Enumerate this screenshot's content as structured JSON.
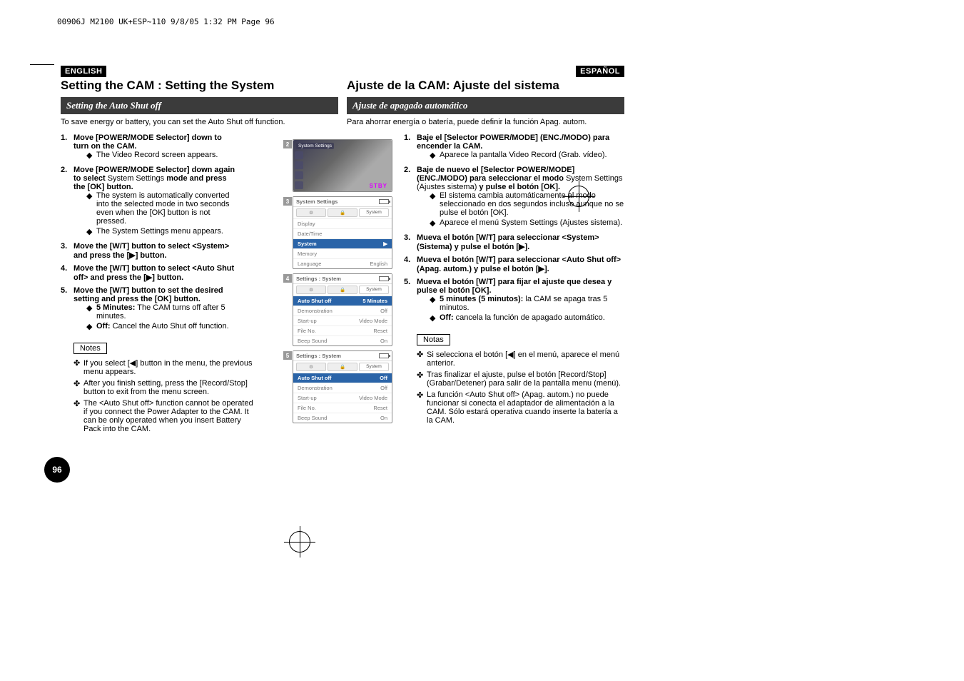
{
  "print_header": "00906J M2100 UK+ESP~110  9/8/05 1:32 PM  Page 96",
  "page_number": "96",
  "left": {
    "lang": "ENGLISH",
    "title": "Setting the CAM : Setting the System",
    "subtitle": "Setting the Auto Shut off",
    "intro": "To save energy or battery, you can set the Auto Shut off function.",
    "steps": [
      {
        "n": "1.",
        "t": "Move [POWER/MODE Selector] down to turn on the CAM.",
        "subs": [
          "The Video Record screen appears."
        ]
      },
      {
        "n": "2.",
        "t": "Move [POWER/MODE Selector] down again to select System Settings mode and press the [OK] button.",
        "subs": [
          "The system is automatically converted into the selected mode in two seconds even when the [OK] button is not pressed.",
          "The System Settings menu appears."
        ]
      },
      {
        "n": "3.",
        "t": "Move the [W/T] button to select <System> and press the [▶] button.",
        "subs": []
      },
      {
        "n": "4.",
        "t": "Move the [W/T] button to select <Auto Shut off> and press the [▶] button.",
        "subs": []
      },
      {
        "n": "5.",
        "t": "Move the [W/T] button to set the desired setting and press the [OK] button.",
        "subs": [
          "5 Minutes: The CAM turns off after 5 minutes.",
          "Off: Cancel the Auto Shut off function."
        ]
      }
    ],
    "notes_label": "Notes",
    "notes": [
      "If you select [◀] button in the menu, the previous menu appears.",
      "After you finish setting, press the [Record/Stop] button to exit from the menu screen.",
      "The <Auto Shut off> function cannot be operated if you connect the Power Adapter to the CAM. It can be only operated when you insert Battery Pack into the CAM."
    ]
  },
  "right": {
    "lang": "ESPAÑOL",
    "title": "Ajuste de la CAM: Ajuste del sistema",
    "subtitle": "Ajuste de apagado automático",
    "intro": "Para ahorrar energía o batería, puede definir la función Apag. autom.",
    "steps": [
      {
        "n": "1.",
        "t": "Baje el [Selector POWER/MODE] (ENC./MODO) para encender la CAM.",
        "subs": [
          "Aparece la pantalla Video Record (Grab. vídeo)."
        ]
      },
      {
        "n": "2.",
        "t": "Baje de nuevo el [Selector POWER/MODE] (ENC./MODO) para seleccionar el modo System Settings (Ajustes sistema) y pulse el botón [OK].",
        "subs": [
          "El sistema cambia automáticamente al modo seleccionado en dos segundos incluso aunque no se pulse el botón [OK].",
          "Aparece el menú System Settings (Ajustes sistema)."
        ]
      },
      {
        "n": "3.",
        "t": "Mueva el botón [W/T] para seleccionar <System> (Sistema) y pulse el botón [▶].",
        "subs": []
      },
      {
        "n": "4.",
        "t": "Mueva el botón [W/T] para seleccionar <Auto Shut off> (Apag. autom.) y pulse el botón [▶].",
        "subs": []
      },
      {
        "n": "5.",
        "t": "Mueva el botón [W/T] para fijar el ajuste que desea y pulse el botón [OK].",
        "subs": [
          "5 minutes (5 minutos): la CAM se apaga tras 5 minutos.",
          "Off: cancela la función de apagado automático."
        ]
      }
    ],
    "notes_label": "Notas",
    "notes": [
      "Si selecciona el botón [◀] en el menú, aparece el menú anterior.",
      "Tras finalizar el ajuste, pulse el botón [Record/Stop] (Grabar/Detener) para salir de la pantalla menu (menú).",
      "La función <Auto Shut off> (Apag. autom.) no puede funcionar si conecta el adaptador de alimentación a la CAM. Sólo estará operativa cuando inserte la batería a la CAM."
    ]
  },
  "shots": {
    "s2": {
      "badge": "2",
      "label": "System Settings",
      "stby": "STBY"
    },
    "s3": {
      "badge": "3",
      "title": "System Settings",
      "tabs": [
        "⚙",
        "🔒",
        "System"
      ],
      "rows": [
        {
          "l": "Display",
          "r": ""
        },
        {
          "l": "Date/Time",
          "r": ""
        },
        {
          "l": "System",
          "r": "▶",
          "hl": true
        },
        {
          "l": "Memory",
          "r": ""
        },
        {
          "l": "Language",
          "r": "English"
        }
      ]
    },
    "s4": {
      "badge": "4",
      "title": "Settings : System",
      "tabs": [
        "⚙",
        "🔒",
        "System"
      ],
      "rows": [
        {
          "l": "Auto Shut off",
          "r": "5 Minutes",
          "hl": true
        },
        {
          "l": "Demonstration",
          "r": "Off"
        },
        {
          "l": "Start-up",
          "r": "Video Mode"
        },
        {
          "l": "File No.",
          "r": "Reset"
        },
        {
          "l": "Beep Sound",
          "r": "On"
        }
      ]
    },
    "s5": {
      "badge": "5",
      "title": "Settings : System",
      "tabs": [
        "⚙",
        "🔒",
        "System"
      ],
      "rows": [
        {
          "l": "Auto Shut off",
          "r": "Off",
          "hl": true
        },
        {
          "l": "Demonstration",
          "r": "Off"
        },
        {
          "l": "Start-up",
          "r": "Video Mode"
        },
        {
          "l": "File No.",
          "r": "Reset"
        },
        {
          "l": "Beep Sound",
          "r": "On"
        }
      ]
    }
  }
}
